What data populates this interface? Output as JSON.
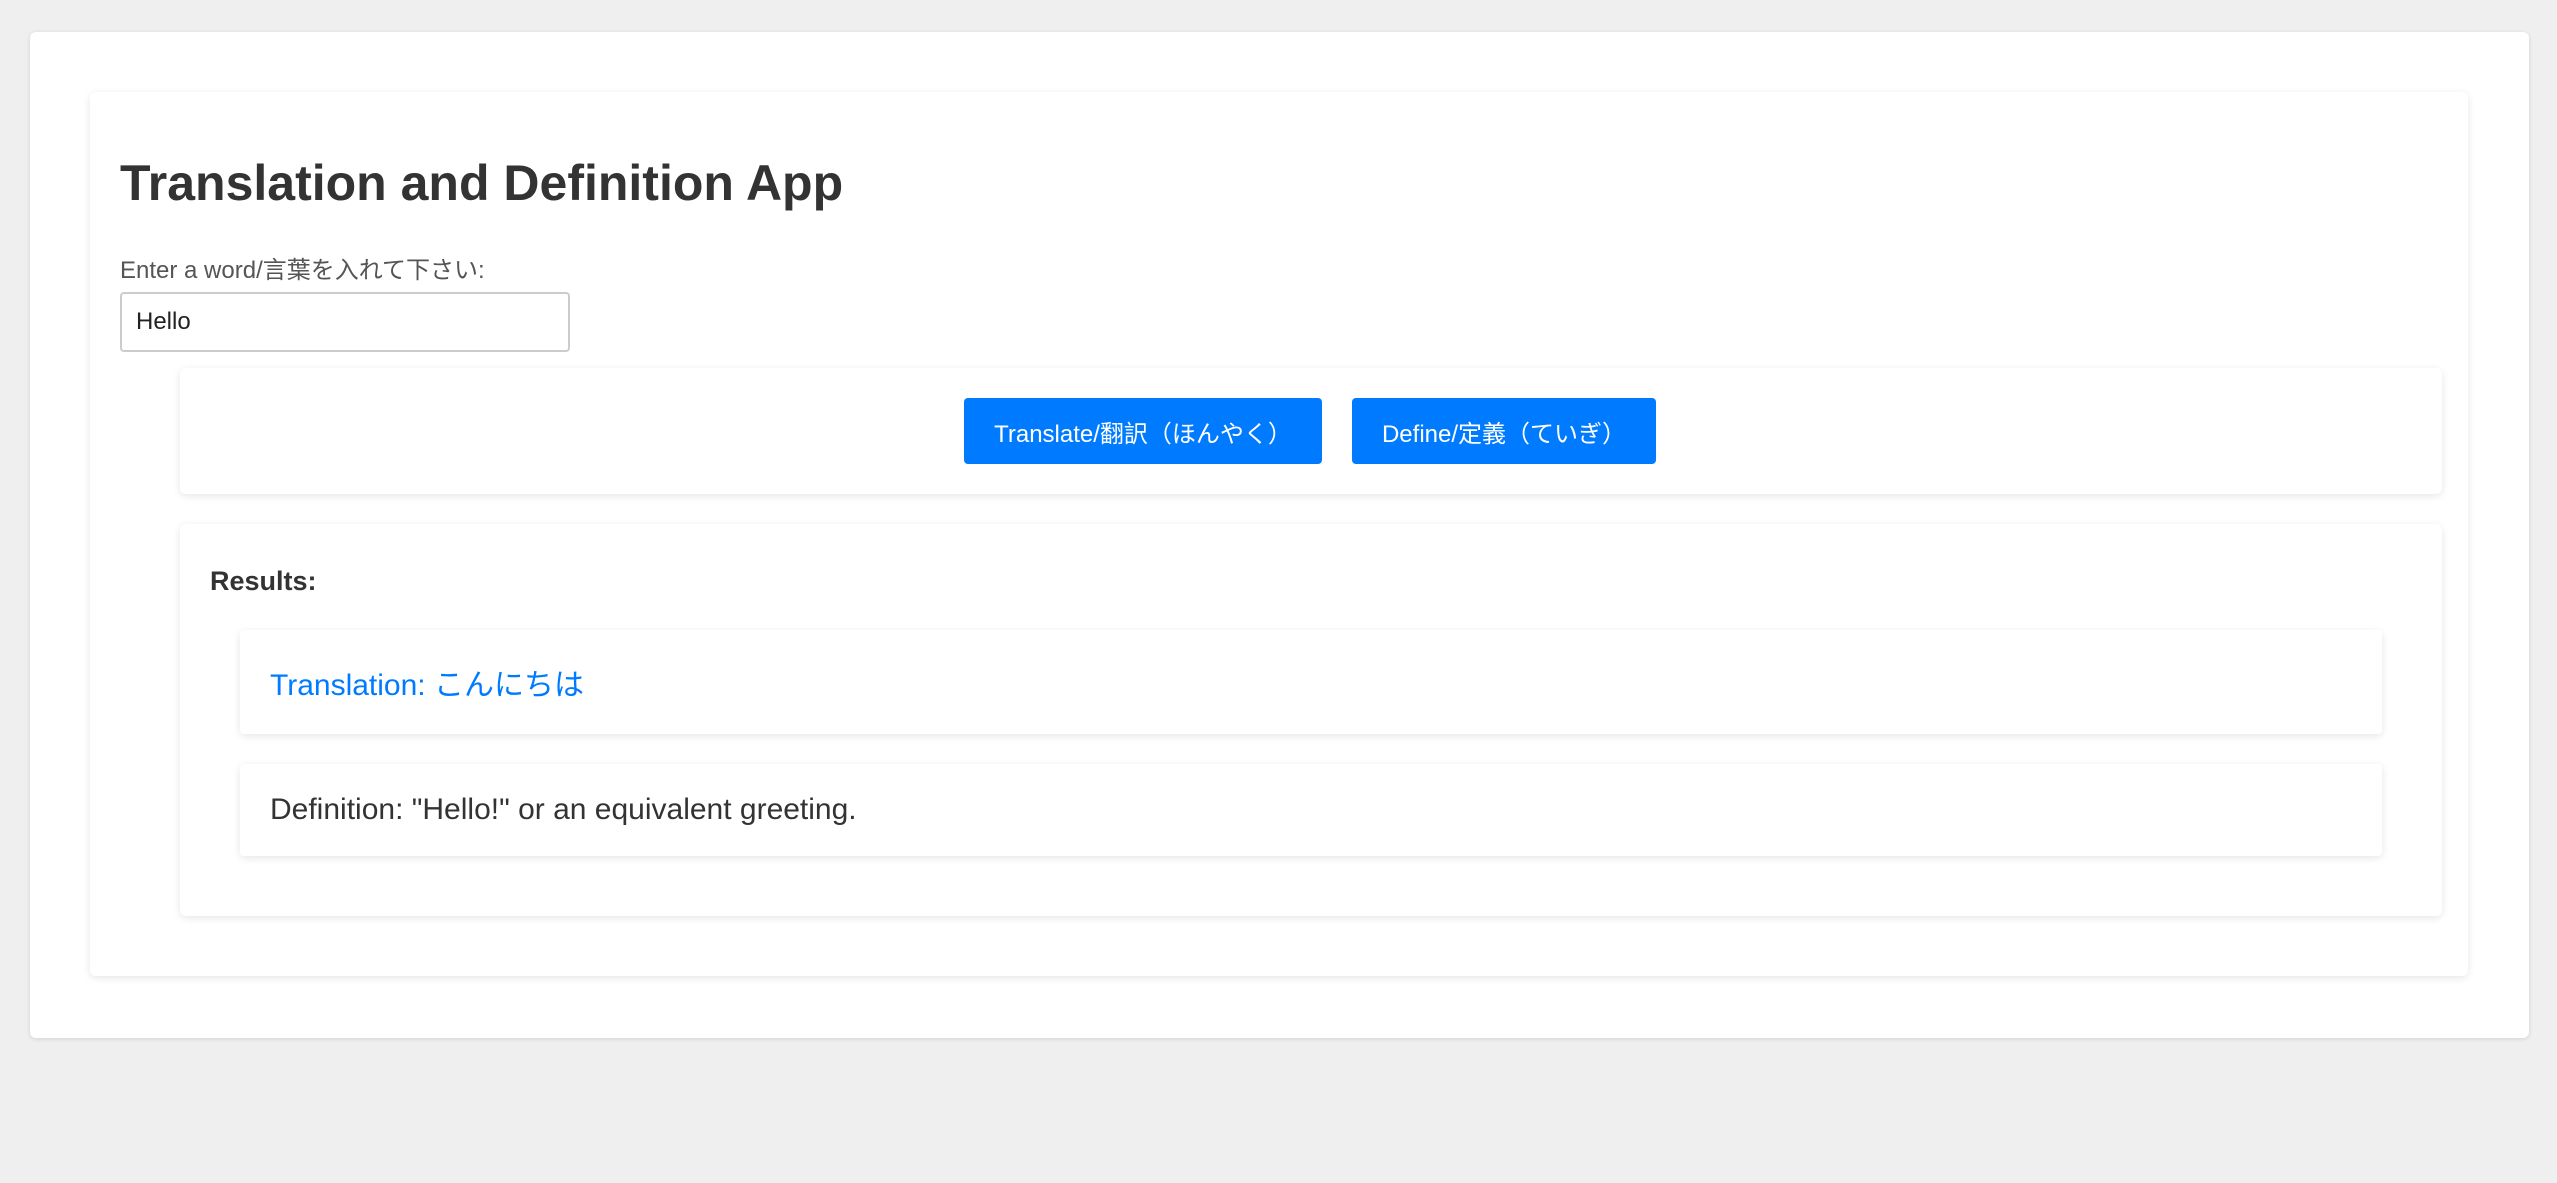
{
  "app": {
    "title": "Translation and Definition App"
  },
  "input": {
    "label": "Enter a word/言葉を入れて下さい:",
    "value": "Hello"
  },
  "buttons": {
    "translate_label": "Translate/翻訳（ほんやく）",
    "define_label": "Define/定義（ていぎ）"
  },
  "results": {
    "heading": "Results:",
    "translation": "Translation: こんにちは",
    "definition": "Definition: \"Hello!\" or an equivalent greeting."
  },
  "colors": {
    "accent": "#007bff",
    "page_background": "#efefef",
    "card_background": "#ffffff",
    "text": "#333333"
  }
}
